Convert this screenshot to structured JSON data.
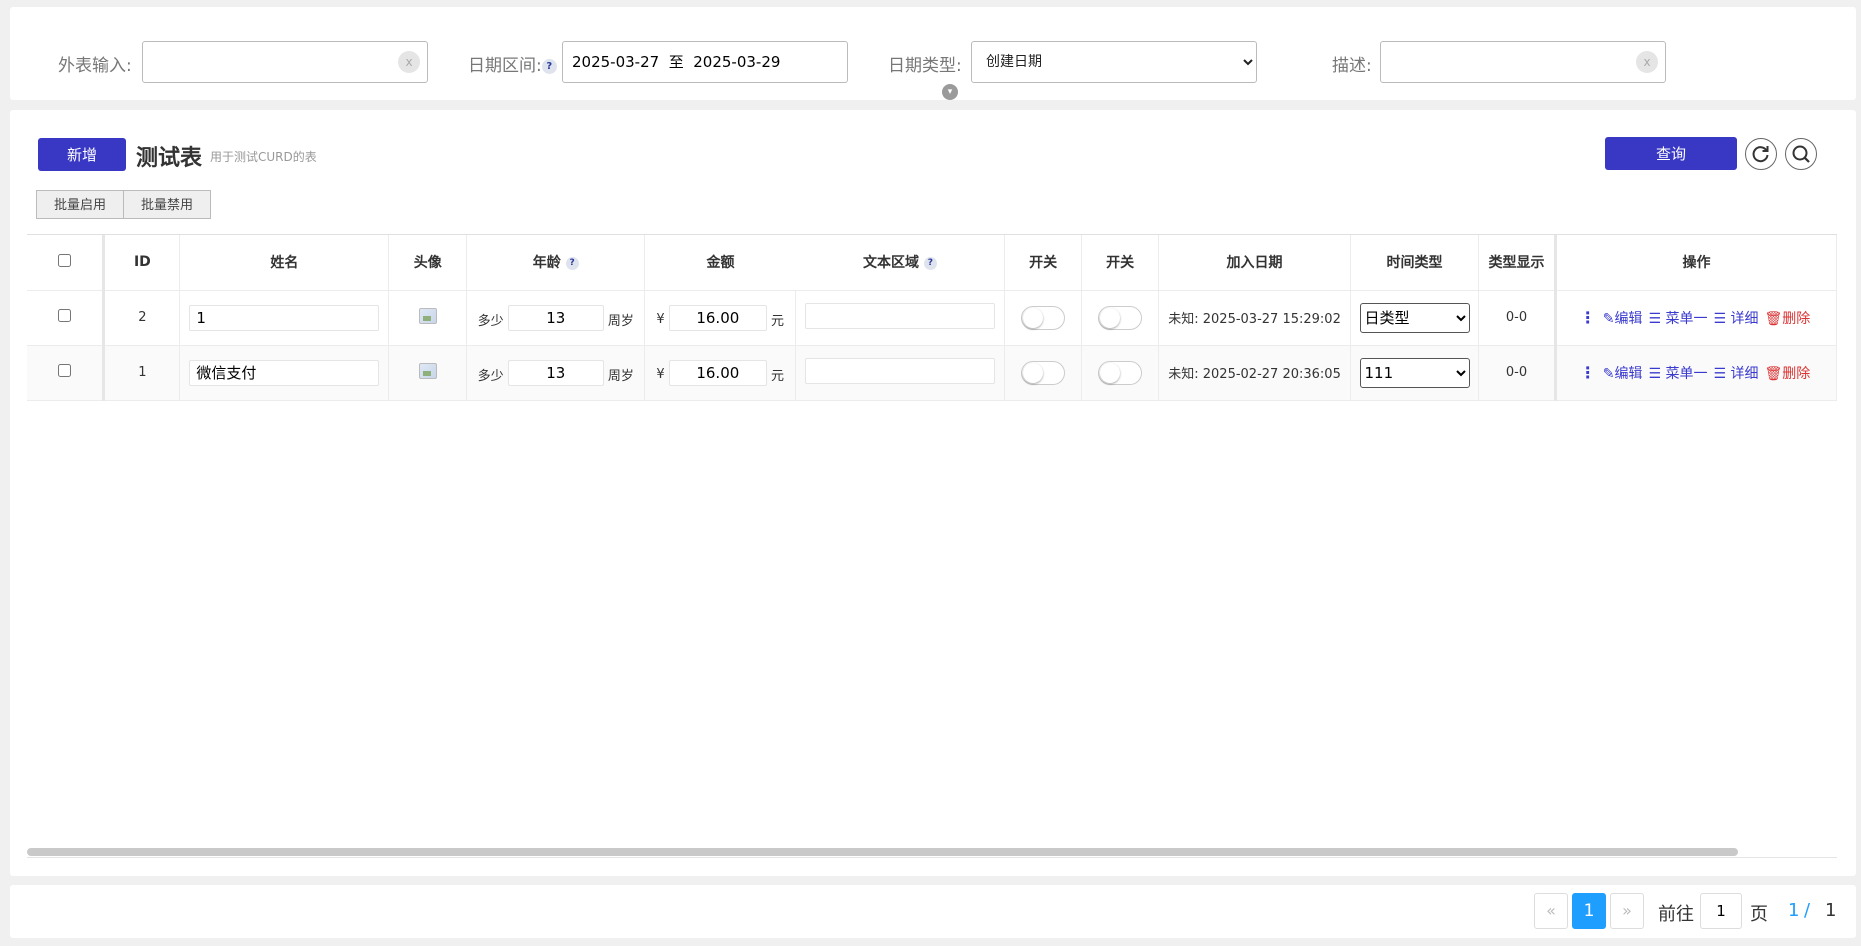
{
  "search": {
    "foreign_label": "外表输入:",
    "foreign_value": "",
    "date_range_label": "日期区间:",
    "date_range_help": "?",
    "date_range_value": "2025-03-27  至  2025-03-29",
    "date_type_label": "日期类型:",
    "date_type_value": "创建日期",
    "desc_label": "描述:",
    "desc_value": "",
    "clear_glyph": "x"
  },
  "toolbar": {
    "add_label": "新增",
    "title": "测试表",
    "subtitle": "用于测试CURD的表",
    "query_label": "查询",
    "batch_enable_label": "批量启用",
    "batch_disable_label": "批量禁用"
  },
  "table": {
    "headers": {
      "id": "ID",
      "name": "姓名",
      "avatar": "头像",
      "age": "年龄",
      "amount": "金额",
      "textarea": "文本区域",
      "switch1": "开关",
      "switch2": "开关",
      "join_date": "加入日期",
      "time_type": "时间类型",
      "type_display": "类型显示",
      "actions": "操作"
    },
    "help_glyph": "?",
    "rows": [
      {
        "id": "2",
        "name": "1",
        "age_prefix": "多少",
        "age": "13",
        "age_suffix": "周岁",
        "amount_prefix": "¥",
        "amount": "16.00",
        "amount_suffix": "元",
        "textarea": "",
        "join_date_prefix": "未知:",
        "join_date": "2025-03-27 15:29:02",
        "time_type": "日类型",
        "type_display": "0-0"
      },
      {
        "id": "1",
        "name": "微信支付",
        "age_prefix": "多少",
        "age": "13",
        "age_suffix": "周岁",
        "amount_prefix": "¥",
        "amount": "16.00",
        "amount_suffix": "元",
        "textarea": "",
        "join_date_prefix": "未知:",
        "join_date": "2025-02-27 20:36:05",
        "time_type": "111",
        "type_display": "0-0"
      }
    ],
    "actions": {
      "edit": "编辑",
      "menu1": "菜单一",
      "detail": "详细",
      "delete": "删除"
    }
  },
  "pager": {
    "prev": "«",
    "current": "1",
    "next": "»",
    "goto_label": "前往",
    "goto_value": "1",
    "page_label": "页",
    "page_current": "1",
    "page_sep": "/",
    "page_total": "1"
  },
  "colors": {
    "primary": "#3838c4",
    "pager_active": "#1e9fff",
    "action_link": "#3a3ad0",
    "danger": "#dd3333"
  }
}
